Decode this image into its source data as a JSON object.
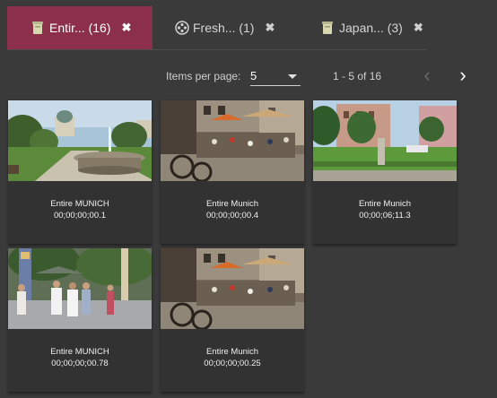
{
  "tabs": [
    {
      "label": "Entir... (16)",
      "icon": "bin-icon",
      "active": true,
      "close": "✖"
    },
    {
      "label": "Fresh... (1)",
      "icon": "film-reel-icon",
      "active": false,
      "close": "✖"
    },
    {
      "label": "Japan... (3)",
      "icon": "bin-icon",
      "active": false,
      "close": "✖"
    }
  ],
  "pager": {
    "items_per_page_label": "Items per page:",
    "items_per_page_value": "5",
    "range": "1 - 5 of 16",
    "prev": "‹",
    "next": "›"
  },
  "clips": [
    {
      "title": "Entire MUNICH",
      "timecode": "00;00;00;00.1",
      "scene": "fountain-park"
    },
    {
      "title": "Entire Munich",
      "timecode": "00;00;00;00.4",
      "scene": "street-cafe"
    },
    {
      "title": "Entire Munich",
      "timecode": "00;00;06;11.3",
      "scene": "city-park"
    },
    {
      "title": "Entire MUNICH",
      "timecode": "00;00;00;00.78",
      "scene": "pedestrians"
    },
    {
      "title": "Entire Munich",
      "timecode": "00;00;00;00.25",
      "scene": "street-cafe"
    }
  ]
}
